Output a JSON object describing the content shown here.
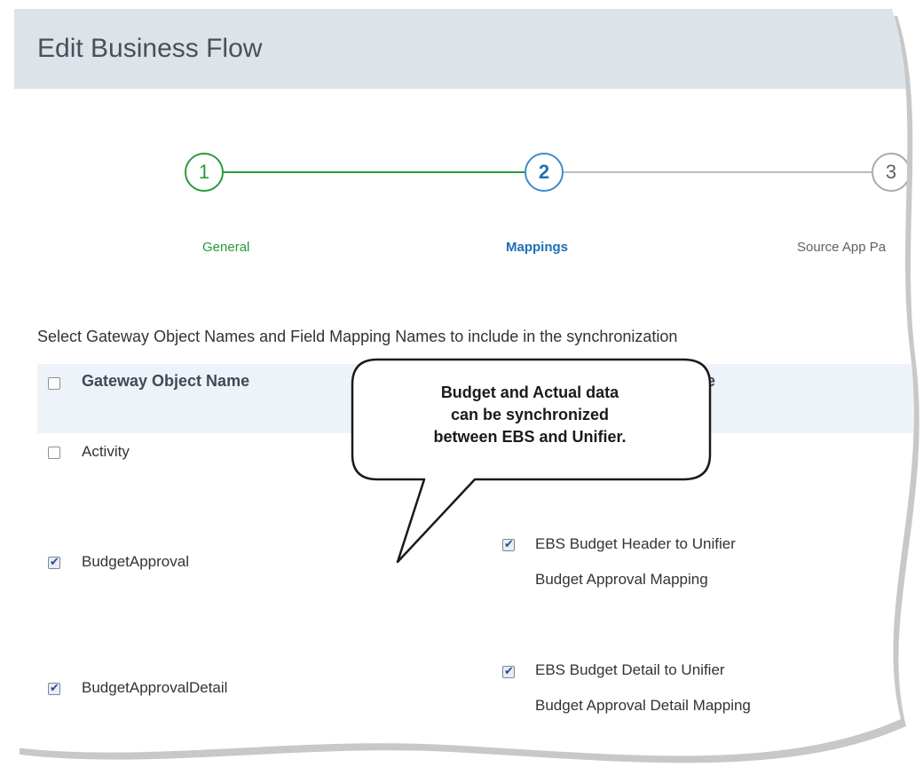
{
  "dialog": {
    "title": "Edit Business Flow"
  },
  "wizard": {
    "steps": [
      {
        "number": "1",
        "label": "General",
        "state": "completed"
      },
      {
        "number": "2",
        "label": "Mappings",
        "state": "active"
      },
      {
        "number": "3",
        "label": "Source App Pa",
        "state": "pending"
      }
    ]
  },
  "instructions": "Select Gateway Object Names and Field Mapping Names to include in the synchronization",
  "table": {
    "headers": {
      "gateway_object": "Gateway Object Name",
      "field_mapping_fragment": "e"
    },
    "rows": [
      {
        "object_name": "Activity",
        "object_checked": false,
        "mapping_line1": "",
        "mapping_line2": ""
      },
      {
        "object_name": "BudgetApproval",
        "object_checked": true,
        "mapping_line1": "EBS Budget Header to Unifier",
        "mapping_line2": "Budget Approval Mapping",
        "mapping_checked": true
      },
      {
        "object_name": "BudgetApprovalDetail",
        "object_checked": true,
        "mapping_line1": "EBS Budget Detail to Unifier",
        "mapping_line2": "Budget Approval Detail Mapping",
        "mapping_checked": true
      }
    ]
  },
  "callout": {
    "line1": "Budget and Actual data",
    "line2": "can be synchronized",
    "line3": "between EBS and Unifier."
  },
  "colors": {
    "header_bg": "#dde4e9",
    "completed": "#2a9a3a",
    "active": "#1f6fb8",
    "pending": "#a7abaf"
  }
}
